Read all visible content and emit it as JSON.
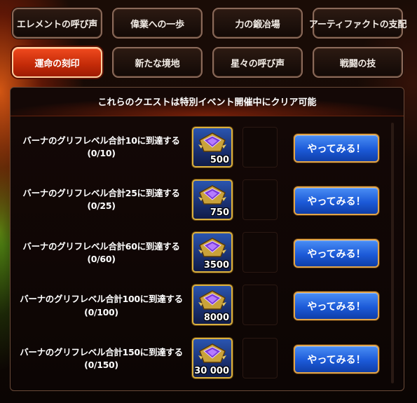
{
  "tabs": [
    {
      "label": "エレメントの呼び声",
      "active": false
    },
    {
      "label": "偉業への一歩",
      "active": false
    },
    {
      "label": "力の鍛冶場",
      "active": false
    },
    {
      "label": "アーティファクトの支配",
      "active": false
    },
    {
      "label": "運命の刻印",
      "active": true
    },
    {
      "label": "新たな境地",
      "active": false
    },
    {
      "label": "星々の呼び声",
      "active": false
    },
    {
      "label": "戦闘の技",
      "active": false
    }
  ],
  "panel": {
    "title": "これらのクエストは特別イベント開催中にクリア可能"
  },
  "quests": [
    {
      "title": "バーナのグリフレベル合計10に到達する",
      "progress": "(0/10)",
      "reward_amount": "500",
      "reward_icon": "glyph-chest-icon",
      "button_label": "やってみる！"
    },
    {
      "title": "バーナのグリフレベル合計25に到達する",
      "progress": "(0/25)",
      "reward_amount": "750",
      "reward_icon": "glyph-chest-icon",
      "button_label": "やってみる！"
    },
    {
      "title": "バーナのグリフレベル合計60に到達する",
      "progress": "(0/60)",
      "reward_amount": "3500",
      "reward_icon": "glyph-chest-icon",
      "button_label": "やってみる！"
    },
    {
      "title": "バーナのグリフレベル合計100に到達する",
      "progress": "(0/100)",
      "reward_amount": "8000",
      "reward_icon": "glyph-chest-icon",
      "button_label": "やってみる！"
    },
    {
      "title": "バーナのグリフレベル合計150に到達する",
      "progress": "(0/150)",
      "reward_amount": "30 000",
      "reward_icon": "glyph-chest-icon",
      "button_label": "やってみる！"
    }
  ],
  "colors": {
    "active_tab": "#d8370f",
    "button_blue": "#1c5ad8",
    "gold_border": "#d9b040"
  }
}
